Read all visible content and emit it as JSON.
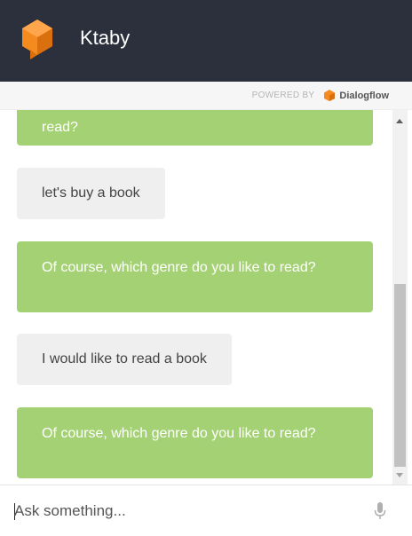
{
  "header": {
    "title": "Ktaby",
    "logo_color": "#f58a1f"
  },
  "powered_by": {
    "label": "POWERED BY",
    "brand": "Dialogflow"
  },
  "messages": [
    {
      "sender": "bot",
      "text": "read?"
    },
    {
      "sender": "user",
      "text": "let's buy a book"
    },
    {
      "sender": "bot",
      "text": "Of course, which genre do you like to read?"
    },
    {
      "sender": "user",
      "text": "I would like to read a book"
    },
    {
      "sender": "bot",
      "text": "Of course, which genre do you like to read?"
    }
  ],
  "input": {
    "placeholder": "Ask something...",
    "mic_icon": "microphone-icon"
  },
  "colors": {
    "header_bg": "#2b303c",
    "bot_bubble": "#a5d175",
    "user_bubble": "#efefef"
  }
}
